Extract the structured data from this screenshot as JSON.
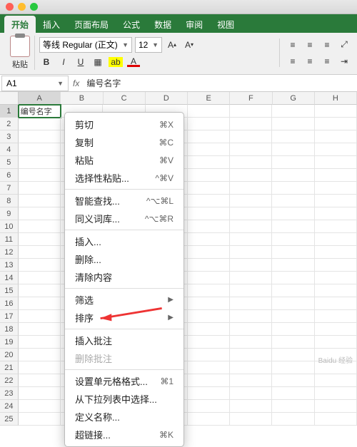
{
  "titlebar": {},
  "tabs": {
    "items": [
      "开始",
      "插入",
      "页面布局",
      "公式",
      "数据",
      "审阅",
      "视图"
    ],
    "active": 0
  },
  "ribbon": {
    "paste": "粘贴",
    "font_name": "等线 Regular (正文)",
    "font_size": "12",
    "bold": "B",
    "italic": "I",
    "underline": "U",
    "fill_label": "A",
    "font_color_label": "A"
  },
  "namebox": {
    "ref": "A1"
  },
  "formula_bar": {
    "fx": "fx",
    "value": "编号名字"
  },
  "columns": [
    "A",
    "B",
    "C",
    "D",
    "E",
    "F",
    "G",
    "H"
  ],
  "rows": 25,
  "cell_A1": "编号名字",
  "context_menu": {
    "cut": "剪切",
    "cut_sc": "⌘X",
    "copy": "复制",
    "copy_sc": "⌘C",
    "paste": "粘贴",
    "paste_sc": "⌘V",
    "paste_special": "选择性粘贴...",
    "paste_special_sc": "^⌘V",
    "smart_lookup": "智能查找...",
    "smart_lookup_sc": "^⌥⌘L",
    "thesaurus": "同义词库...",
    "thesaurus_sc": "^⌥⌘R",
    "insert": "插入...",
    "delete": "删除...",
    "clear": "清除内容",
    "filter": "筛选",
    "sort": "排序",
    "insert_comment": "插入批注",
    "delete_comment": "删除批注",
    "format_cells": "设置单元格格式...",
    "format_cells_sc": "⌘1",
    "pick_list": "从下拉列表中选择...",
    "define_name": "定义名称...",
    "hyperlink": "超链接...",
    "hyperlink_sc": "⌘K"
  },
  "watermark": "Baidu 经验"
}
